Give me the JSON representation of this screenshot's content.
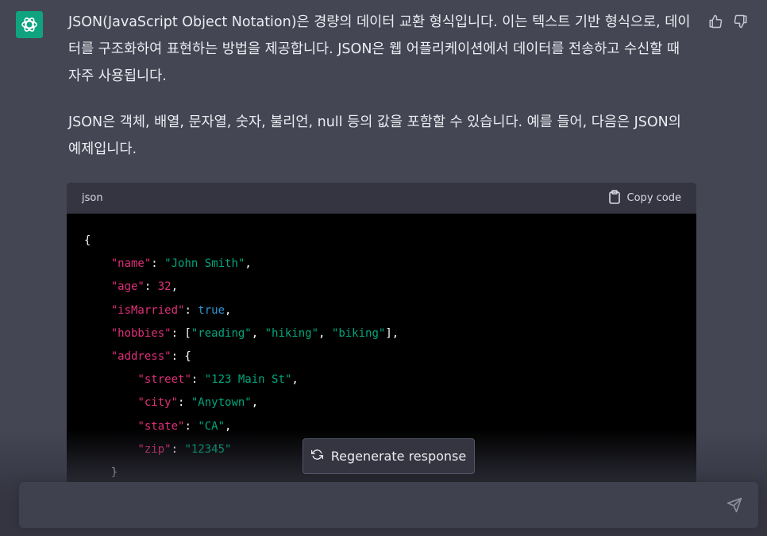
{
  "message": {
    "paragraph1": "JSON(JavaScript Object Notation)은 경량의 데이터 교환 형식입니다. 이는 텍스트 기반 형식으로, 데이터를 구조화하여 표현하는 방법을 제공합니다. JSON은 웹 어플리케이션에서 데이터를 전송하고 수신할 때 자주 사용됩니다.",
    "paragraph2": "JSON은 객체, 배열, 문자열, 숫자, 불리언, null 등의 값을 포함할 수 있습니다. 예를 들어, 다음은 JSON의 예제입니다."
  },
  "code_block": {
    "language": "json",
    "copy_label": "Copy code",
    "tokens": {
      "open_brace": "{",
      "name_key": "\"name\"",
      "name_val": "\"John Smith\"",
      "age_key": "\"age\"",
      "age_val": "32",
      "married_key": "\"isMarried\"",
      "married_val": "true",
      "hobbies_key": "\"hobbies\"",
      "hobby1": "\"reading\"",
      "hobby2": "\"hiking\"",
      "hobby3": "\"biking\"",
      "address_key": "\"address\"",
      "street_key": "\"street\"",
      "street_val": "\"123 Main St\"",
      "city_key": "\"city\"",
      "city_val": "\"Anytown\"",
      "state_key": "\"state\"",
      "state_val": "\"CA\"",
      "zip_key": "\"zip\"",
      "zip_val": "\"12345\"",
      "close_brace": "}"
    }
  },
  "regenerate_label": "Regenerate response",
  "input": {
    "placeholder": ""
  },
  "icons": {
    "avatar": "openai-logo-icon",
    "like": "thumbs-up-icon",
    "dislike": "thumbs-down-icon",
    "copy": "clipboard-icon",
    "regenerate": "refresh-icon",
    "send": "send-icon"
  },
  "colors": {
    "accent": "#10a37f",
    "background": "#444654",
    "code_key": "#df3079",
    "code_string": "#00a67d",
    "code_bool": "#2e95d3"
  }
}
